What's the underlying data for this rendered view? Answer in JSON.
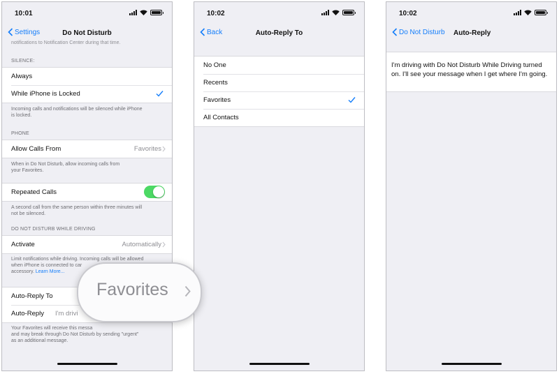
{
  "accent": "#147efb",
  "toggle_on_color": "#4cd964",
  "screen1": {
    "time": "10:01",
    "back": "Settings",
    "title": "Do Not Disturb",
    "cut_footer": "notifications to Notification Center during that time.",
    "silence_header": "SILENCE:",
    "always": "Always",
    "while_locked": "While iPhone is Locked",
    "silence_footer_1": "Incoming calls and notifications will be silenced while iPhone",
    "silence_footer_2": "is locked.",
    "phone_header": "PHONE",
    "allow_calls_label": "Allow Calls From",
    "allow_calls_value": "Favorites",
    "phone_footer_1": "When in Do Not Disturb, allow incoming calls from",
    "phone_footer_2": "your Favorites.",
    "repeated_calls": "Repeated Calls",
    "repeated_calls_on": true,
    "repeated_footer_1": "A second call from the same person within three minutes will",
    "repeated_footer_2": "not be silenced.",
    "driving_header": "DO NOT DISTURB WHILE DRIVING",
    "activate_label": "Activate",
    "activate_value": "Automatically",
    "driving_footer_1": "Limit notifications while driving. Incoming calls will be allowed",
    "driving_footer_2": "when iPhone is connected to car",
    "driving_footer_3": "accessory.",
    "learn_more": "Learn More...",
    "auto_reply_to_label": "Auto-Reply To",
    "auto_reply_label": "Auto-Reply",
    "auto_reply_value": "I'm drivi",
    "bottom_footer_1": "Your Favorites will receive this messa",
    "bottom_footer_2": "and may break through Do Not Disturb by sending \"urgent\"",
    "bottom_footer_3": "as an additional message.",
    "magnifier_label": "Favorites"
  },
  "screen2": {
    "time": "10:02",
    "back": "Back",
    "title": "Auto-Reply To",
    "options": [
      "No One",
      "Recents",
      "Favorites",
      "All Contacts"
    ],
    "selected_index": 2
  },
  "screen3": {
    "time": "10:02",
    "back": "Do Not Disturb",
    "title": "Auto-Reply",
    "message": "I'm driving with Do Not Disturb While Driving turned on. I'll see your message when I get where I'm going."
  }
}
